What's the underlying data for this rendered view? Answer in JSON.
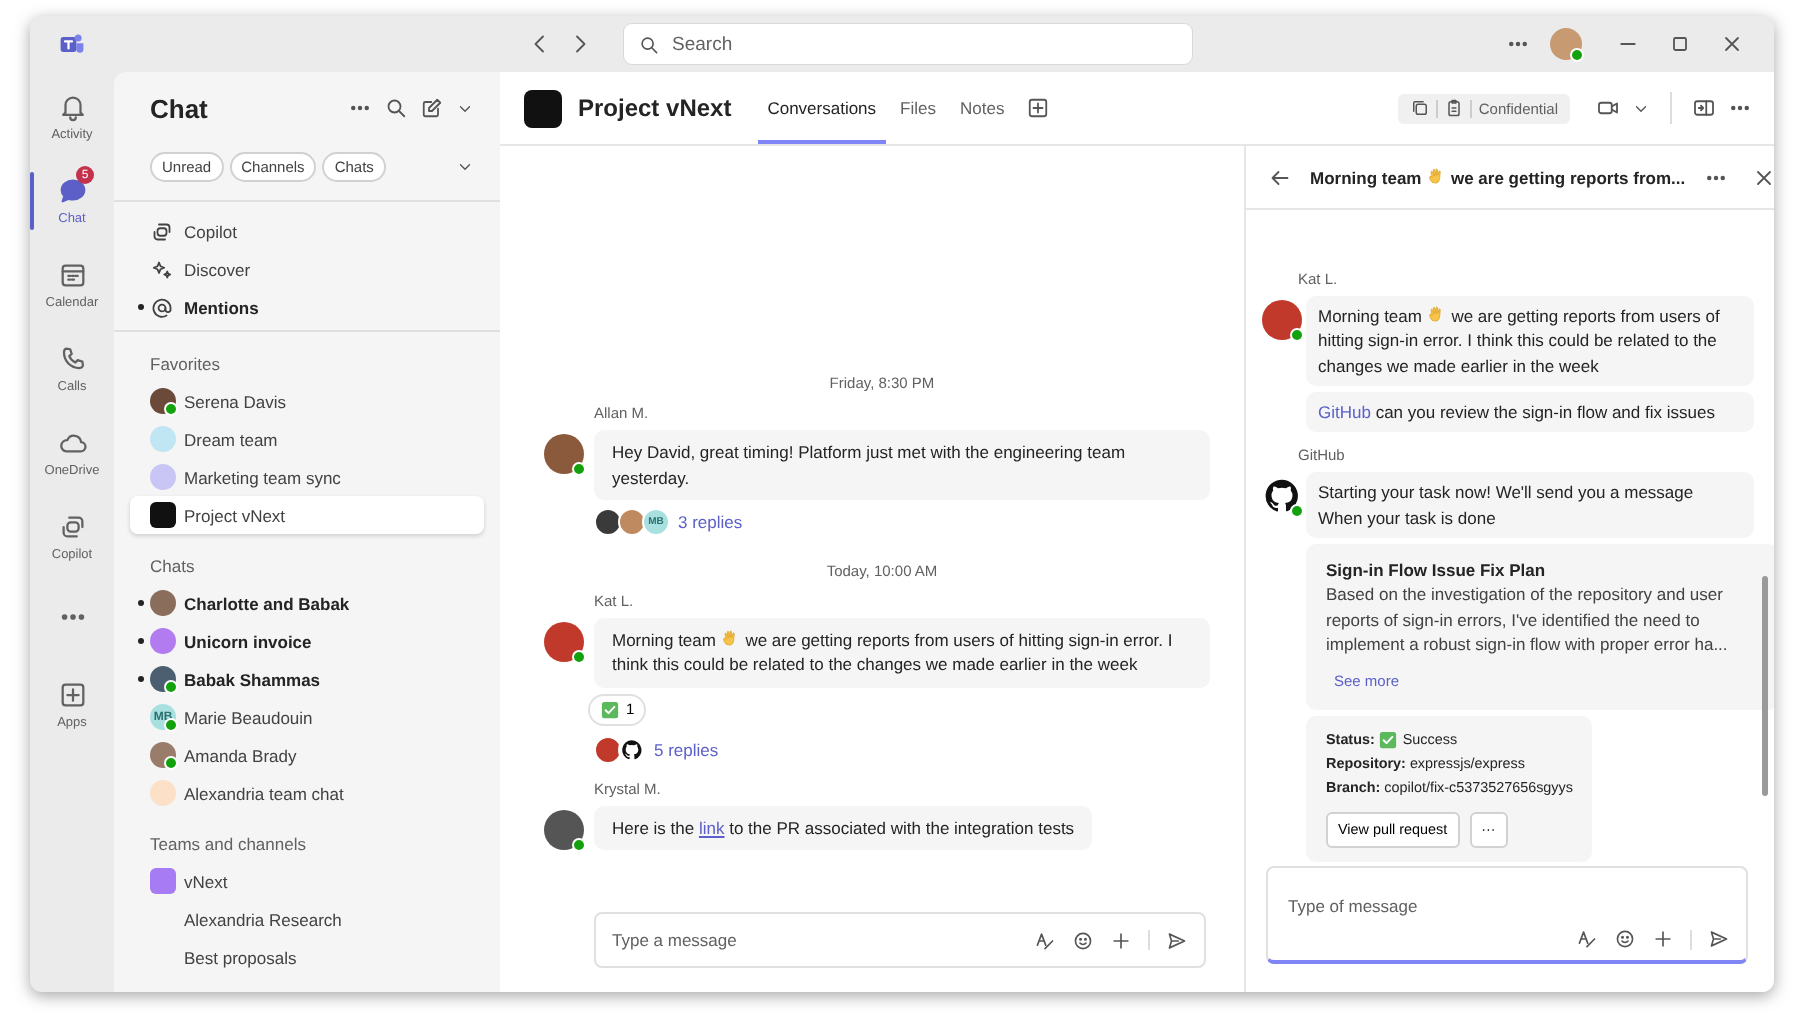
{
  "title_bar": {
    "search": {
      "placeholder": "Search"
    },
    "user_avatar": {
      "color": "#c89a72",
      "presence": true
    }
  },
  "rail": [
    {
      "label": "Activity",
      "selected": false
    },
    {
      "label": "Chat",
      "selected": true,
      "badge": "5"
    },
    {
      "label": "Calendar",
      "selected": false
    },
    {
      "label": "Calls",
      "selected": false
    },
    {
      "label": "OneDrive",
      "selected": false
    },
    {
      "label": "Copilot",
      "selected": false
    },
    {
      "selected": false
    },
    {
      "label": "Apps",
      "selected": false
    }
  ],
  "chat_list": {
    "title": "Chat",
    "filters": [
      "Unread",
      "Channels",
      "Chats"
    ],
    "sections": [
      {
        "items": [
          {
            "kind": "nav",
            "label": "Copilot",
            "unread": false,
            "selected": false
          },
          {
            "kind": "nav",
            "label": "Discover",
            "unread": false,
            "selected": false
          },
          {
            "kind": "nav",
            "label": "Mentions",
            "unread": true,
            "selected": false
          }
        ]
      },
      {
        "heading": "Favorites",
        "items": [
          {
            "kind": "person",
            "label": "Serena Davis",
            "unread": false,
            "selected": false,
            "avatar": {
              "color": "#6b4a3a",
              "presence": true
            }
          },
          {
            "kind": "person",
            "label": "Dream team",
            "unread": false,
            "selected": false,
            "avatar": {
              "color": "#bfe6f2"
            }
          },
          {
            "kind": "person",
            "label": "Marketing team sync",
            "unread": false,
            "selected": false,
            "avatar": {
              "color": "#c9c6f5"
            }
          },
          {
            "kind": "team",
            "label": "Project vNext",
            "unread": false,
            "selected": true,
            "avatar": {
              "color": "#111111"
            }
          }
        ]
      },
      {
        "heading": "Chats",
        "items": [
          {
            "kind": "person",
            "label": "Charlotte and Babak",
            "unread": true,
            "selected": false,
            "avatar": {
              "color": "#8a6d5a"
            }
          },
          {
            "kind": "person",
            "label": "Unicorn invoice",
            "unread": true,
            "selected": false,
            "avatar": {
              "color": "#b27cf0"
            }
          },
          {
            "kind": "person",
            "label": "Babak Shammas",
            "unread": true,
            "selected": false,
            "avatar": {
              "color": "#4c5f70",
              "presence": true
            }
          },
          {
            "kind": "person",
            "label": "Marie Beaudouin",
            "unread": false,
            "selected": false,
            "avatar": {
              "color": "#a8e0e0",
              "initials": "MB",
              "presence": true
            }
          },
          {
            "kind": "person",
            "label": "Amanda Brady",
            "unread": false,
            "selected": false,
            "avatar": {
              "color": "#9a7c6a",
              "presence": true
            }
          },
          {
            "kind": "person",
            "label": "Alexandria team chat",
            "unread": false,
            "selected": false,
            "avatar": {
              "color": "#fde0c8"
            }
          }
        ]
      },
      {
        "heading": "Teams and channels",
        "items": [
          {
            "kind": "team",
            "label": "vNext",
            "unread": false,
            "selected": false,
            "avatar": {
              "color": "#a77bf3"
            }
          },
          {
            "kind": "channel",
            "label": "Alexandria Research",
            "unread": false,
            "selected": false
          },
          {
            "kind": "channel",
            "label": "Best proposals",
            "unread": false,
            "selected": false
          }
        ]
      }
    ]
  },
  "header": {
    "title": "Project vNext",
    "tabs": [
      {
        "label": "Conversations",
        "selected": true
      },
      {
        "label": "Files",
        "selected": false
      },
      {
        "label": "Notes",
        "selected": false
      }
    ],
    "sensitivity": "Confidential"
  },
  "conversation": [
    {
      "kind": "divider",
      "text": "Friday, 8:30 PM"
    },
    {
      "kind": "message",
      "author": "Allan M.",
      "avatar": {
        "color": "#8b5a3c",
        "presence": true
      },
      "bubbles": [
        {
          "kind": "text",
          "segments": [
            {
              "kind": "text",
              "text": "Hey David, great timing! Platform just met with the engineering team yesterday."
            }
          ]
        }
      ],
      "replies": {
        "avatars": [
          {
            "color": "#3a3a3a"
          },
          {
            "color": "#c08a60"
          },
          {
            "color": "#a8e0e0",
            "initials": "MB"
          }
        ],
        "label": "3 replies"
      }
    },
    {
      "kind": "divider",
      "text": "Today, 10:00 AM"
    },
    {
      "kind": "message",
      "author": "Kat L.",
      "avatar": {
        "color": "#c0392b",
        "presence": true
      },
      "bubbles": [
        {
          "kind": "text",
          "segments": [
            {
              "kind": "text",
              "text": "Morning team "
            },
            {
              "kind": "wave"
            },
            {
              "kind": "text",
              "text": " we are getting reports from users of hitting sign-in error. I think this could be related to the changes we made earlier in the week"
            }
          ]
        }
      ],
      "reactions": [
        {
          "count": "1"
        }
      ],
      "replies": {
        "avatars": [
          {
            "color": "#c0392b"
          },
          {
            "kind": "bot"
          }
        ],
        "label": "5 replies"
      }
    },
    {
      "kind": "message",
      "author": "Krystal M.",
      "avatar": {
        "color": "#555555",
        "presence": true
      },
      "bubbles": [
        {
          "kind": "text",
          "segments": [
            {
              "kind": "text",
              "text": "Here is the "
            },
            {
              "kind": "link",
              "text": "link"
            },
            {
              "kind": "text",
              "text": " to the PR associated with the integration tests"
            }
          ]
        }
      ]
    }
  ],
  "compose": {
    "placeholder": "Type a message"
  },
  "thread": {
    "title": [
      {
        "kind": "text",
        "text": "Morning team "
      },
      {
        "kind": "wave"
      },
      {
        "kind": "text",
        "text": " we are getting reports from..."
      }
    ],
    "messages": [
      {
        "author": "Kat L.",
        "avatar": {
          "color": "#c0392b",
          "presence": true
        },
        "bubbles": [
          {
            "kind": "text",
            "segments": [
              {
                "kind": "text",
                "text": "Morning team "
              },
              {
                "kind": "wave"
              },
              {
                "kind": "text",
                "text": " we are getting reports from users of hitting sign-in error. I think this could be related to the changes we made earlier in the week"
              }
            ]
          },
          {
            "kind": "text",
            "segments": [
              {
                "kind": "link",
                "text": "GitHub"
              },
              {
                "kind": "text",
                "text": " can you review the sign-in flow and fix issues"
              }
            ]
          }
        ]
      },
      {
        "author": "GitHub",
        "avatar": {
          "kind": "bot",
          "presence": true
        },
        "bubbles": [
          {
            "kind": "text",
            "segments": [
              {
                "kind": "text",
                "text": "Starting your task now! We'll send you a message When your task is done"
              }
            ]
          },
          {
            "kind": "plan",
            "title": "Sign-in Flow Issue Fix Plan",
            "body": "Based on the investigation of the repository and user reports of sign-in errors, I've identified the need to implement a robust sign-in flow with proper error ha...",
            "link": "See more"
          },
          {
            "kind": "status",
            "fields": [
              {
                "label": "Status:",
                "value": "Success",
                "check": true
              },
              {
                "label": "Repository:",
                "value": "expressjs/express",
                "check": false
              },
              {
                "label": "Branch:",
                "value": "copilot/fix-c5373527656sgyys",
                "check": false
              }
            ],
            "buttons": [
              "View pull request",
              "···"
            ]
          }
        ]
      }
    ],
    "compose": {
      "placeholder": "Type of message"
    }
  }
}
